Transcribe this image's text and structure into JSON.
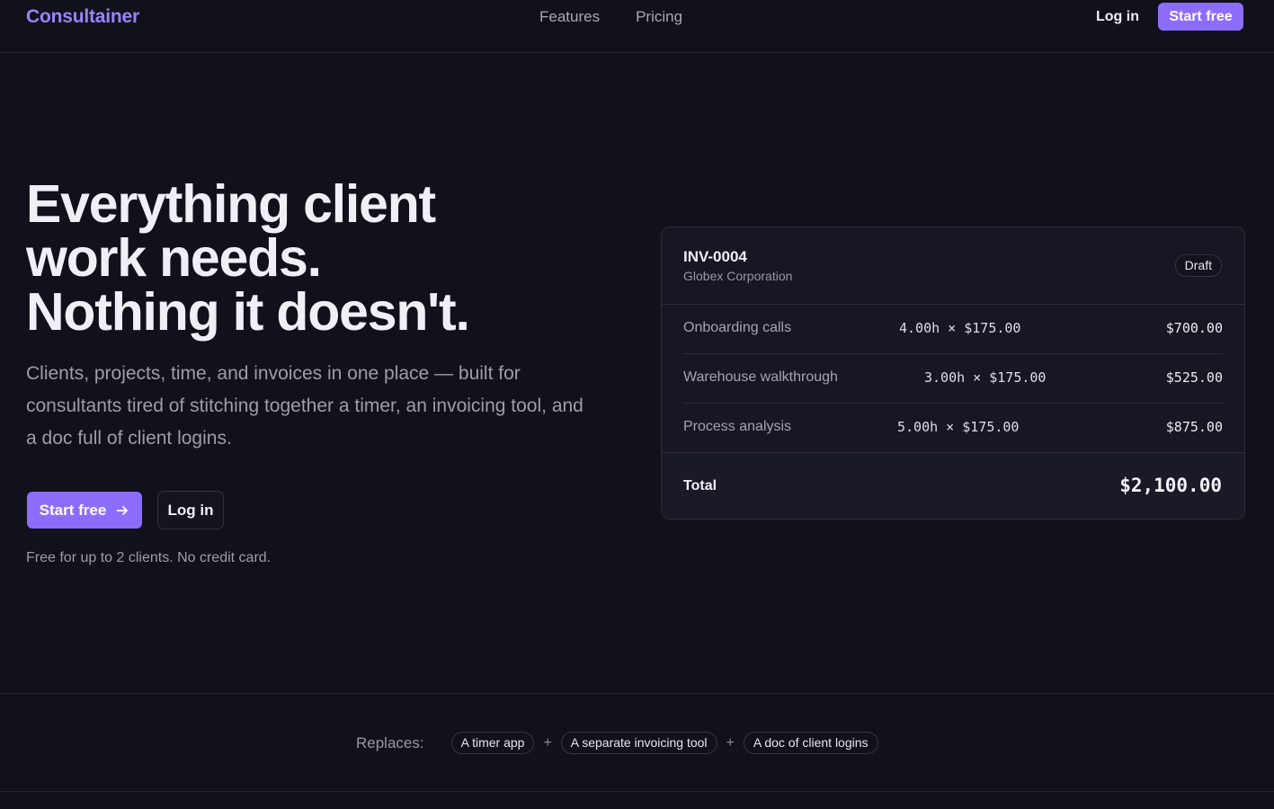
{
  "nav": {
    "brand": "Consultainer",
    "links": [
      "Features",
      "Pricing"
    ],
    "login": "Log in",
    "cta": "Start free"
  },
  "hero": {
    "title_lines": [
      "Everything client",
      "work needs.",
      "Nothing it doesn't."
    ],
    "subtitle": "Clients, projects, time, and invoices in one place — built for consultants tired of stitching together a timer, an invoicing tool, and a doc full of client logins.",
    "primary_button": "Start free",
    "secondary_button": "Log in",
    "note": "Free for up to 2 clients. No credit card."
  },
  "invoice": {
    "number": "INV-0004",
    "client": "Globex Corporation",
    "status": "Draft",
    "lines": [
      {
        "description": "Onboarding calls",
        "quantity": "4.00h × $175.00",
        "amount": "$700.00"
      },
      {
        "description": "Warehouse walkthrough",
        "quantity": "3.00h × $175.00",
        "amount": "$525.00"
      },
      {
        "description": "Process analysis",
        "quantity": "5.00h × $175.00",
        "amount": "$875.00"
      }
    ],
    "total_label": "Total",
    "total": "$2,100.00"
  },
  "replaces": {
    "label": "Replaces:",
    "items": [
      "A timer app",
      "A separate invoicing tool",
      "A doc of client logins"
    ],
    "separator": "+"
  },
  "colors": {
    "background": "#11111b",
    "accent": "#8c6dfb",
    "brand": "#9a83ff"
  },
  "icons": {
    "primary_button_icon": "arrow-right-icon"
  }
}
